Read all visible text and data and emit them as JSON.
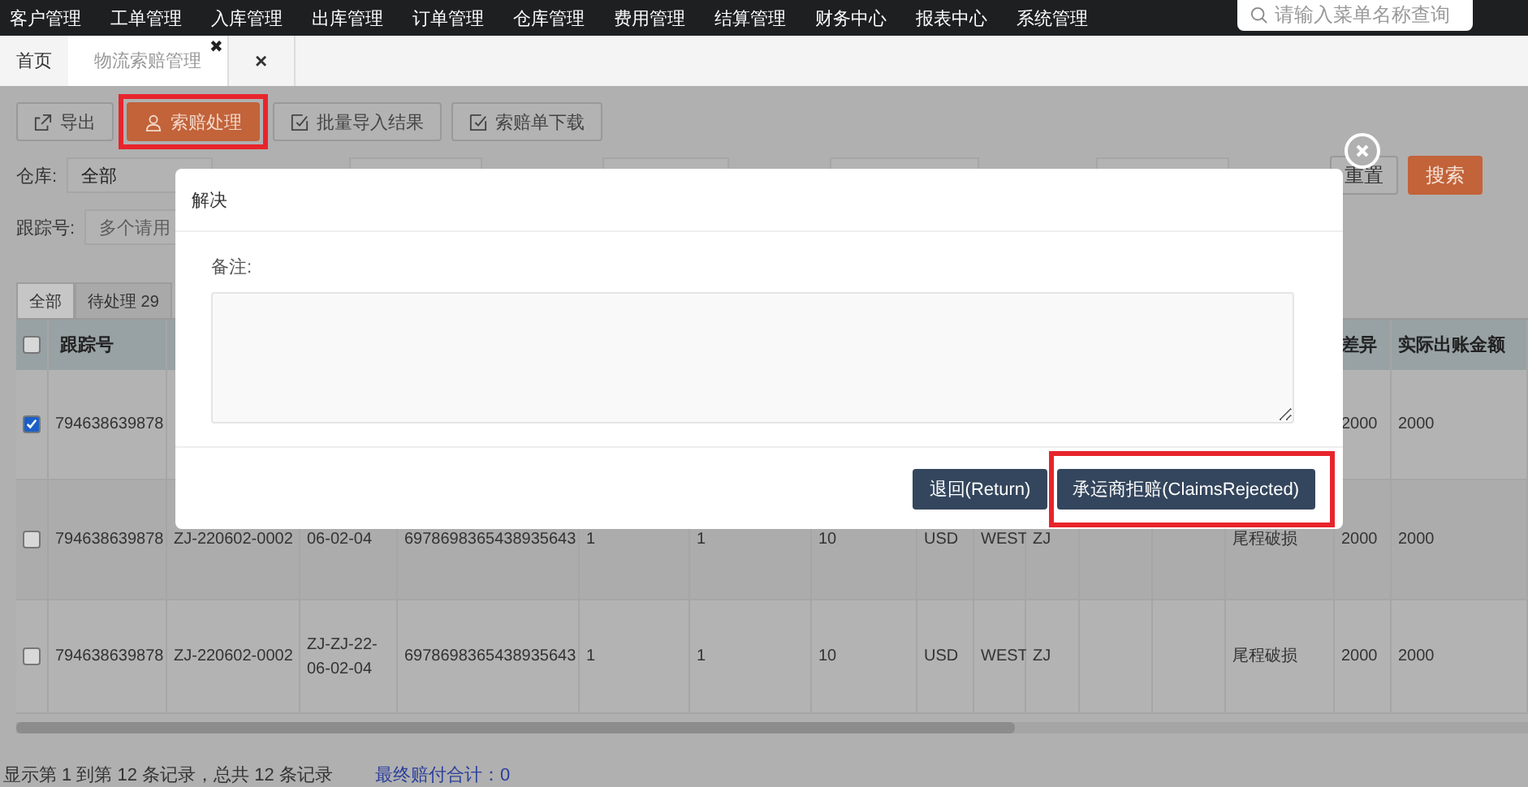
{
  "top_menu": [
    {
      "label": "客户管理"
    },
    {
      "label": "工单管理"
    },
    {
      "label": "入库管理"
    },
    {
      "label": "出库管理"
    },
    {
      "label": "订单管理"
    },
    {
      "label": "仓库管理"
    },
    {
      "label": "费用管理"
    },
    {
      "label": "结算管理"
    },
    {
      "label": "财务中心"
    },
    {
      "label": "报表中心"
    },
    {
      "label": "系统管理"
    }
  ],
  "menu_search": {
    "placeholder": "请输入菜单名称查询"
  },
  "page_tabs": [
    {
      "label": "首页",
      "selected": false
    },
    {
      "label": "物流索赔管理",
      "selected": true,
      "close": "✖"
    }
  ],
  "close_all_tab": "×",
  "toolbar": [
    {
      "label": "导出",
      "kind": "export",
      "highlighted": false
    },
    {
      "label": "索赔处理",
      "kind": "primary",
      "highlighted": true
    },
    {
      "label": "批量导入结果",
      "kind": "import",
      "highlighted": false
    },
    {
      "label": "索赔单下载",
      "kind": "import",
      "highlighted": false
    }
  ],
  "filters": {
    "warehouse_label": "仓库:",
    "warehouse_value": "全部",
    "reset": "重置",
    "search": "搜索",
    "tracking_label": "跟踪号:",
    "tracking_placeholder": "多个请用"
  },
  "status_tabs": [
    {
      "label": "全部",
      "selected": true
    },
    {
      "label": "待处理 29",
      "selected": false
    }
  ],
  "table": {
    "headers": {
      "column_2": "跟踪号",
      "column_15": "差异",
      "column_16": "实际出账金额"
    },
    "header_checked": false,
    "rows": [
      {
        "checked": true,
        "cells": {
          "column_2": "794638639878",
          "column_15": "2000",
          "column_16": "2000"
        }
      },
      {
        "checked": false,
        "cells": {
          "column_2": "794638639878",
          "column_3": "ZJ-220602-0002",
          "column_4": "06-02-04",
          "column_5": "6978698365438935643",
          "column_6": "1",
          "column_7": "1",
          "column_8": "10",
          "column_9": "USD",
          "column_10": "WEST",
          "column_11": "ZJ",
          "column_14": "尾程破损",
          "column_15": "2000",
          "column_16": "2000"
        }
      },
      {
        "checked": false,
        "cells": {
          "column_2": "794638639878",
          "column_3": "ZJ-220602-0002",
          "column_4": "ZJ-ZJ-22-06-02-04",
          "column_5": "6978698365438935643",
          "column_6": "1",
          "column_7": "1",
          "column_8": "10",
          "column_9": "USD",
          "column_10": "WEST",
          "column_11": "ZJ",
          "column_14": "尾程破损",
          "column_15": "2000",
          "column_16": "2000"
        }
      }
    ]
  },
  "footer": {
    "summary": "显示第 1 到第 12 条记录，总共 12 条记录",
    "total": "最终赔付合计：0"
  },
  "dialog": {
    "title": "解决",
    "remark_label": "备注:",
    "buttons": [
      {
        "label": "退回(Return)",
        "highlighted": false
      },
      {
        "label": "承运商拒赔(ClaimsRejected)",
        "highlighted": true
      }
    ]
  }
}
